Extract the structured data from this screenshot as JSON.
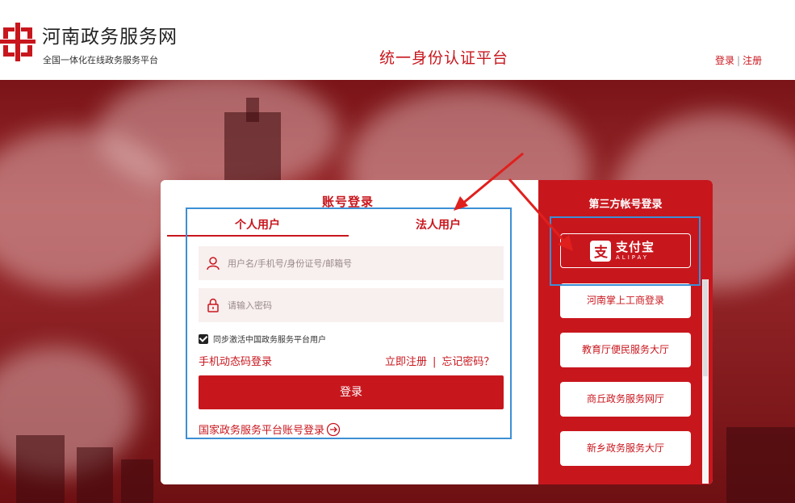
{
  "header": {
    "site_name": "河南政务服务网",
    "slogan": "全国一体化在线政务服务平台",
    "platform_title": "统一身份认证平台",
    "login_link": "登录",
    "separator": "|",
    "register_link": "注册"
  },
  "login": {
    "title": "账号登录",
    "tabs": {
      "personal": "个人用户",
      "legal": "法人用户"
    },
    "username_placeholder": "用户名/手机号/身份证号/邮箱号",
    "password_placeholder": "请输入密码",
    "sync_label": "同步激活中国政务服务平台用户",
    "sync_checked": true,
    "sms_login": "手机动态码登录",
    "register_now": "立即注册",
    "link_separator": "|",
    "forgot_password": "忘记密码？",
    "submit_label": "登录",
    "national_login": "国家政务服务平台账号登录"
  },
  "third_party": {
    "title": "第三方帐号登录",
    "alipay_cn": "支付宝",
    "alipay_en": "ALIPAY",
    "options": [
      "河南掌上工商登录",
      "教育厅便民服务大厅",
      "商丘政务服务网厅",
      "新乡政务服务大厅"
    ]
  },
  "colors": {
    "brand_red": "#c8161d",
    "annotation_blue": "#3d8fd4",
    "annotation_arrow": "#e0201d"
  }
}
